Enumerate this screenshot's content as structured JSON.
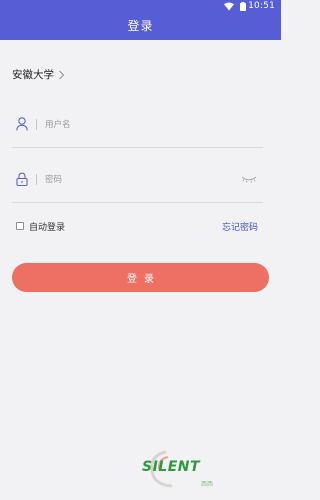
{
  "status_bar": {
    "time": "10:51",
    "icons": [
      "wifi-icon",
      "battery-icon"
    ]
  },
  "header": {
    "title": "登录"
  },
  "school": {
    "name": "安徽大学",
    "icon": "chevron-right-icon"
  },
  "username": {
    "placeholder": "用户名",
    "value": "",
    "icon": "user-icon"
  },
  "password": {
    "placeholder": "密码",
    "value": "",
    "icon": "lock-icon",
    "toggle_icon": "eye-closed-icon"
  },
  "options": {
    "auto_login_label": "自动登录",
    "auto_login_checked": false,
    "forgot_label": "忘记密码"
  },
  "login_button": {
    "label": "登录"
  },
  "watermark": {
    "text": "SILENT",
    "subtext": "西西"
  },
  "colors": {
    "header": "#575dd4",
    "button": "#ee6f63",
    "link": "#3d4fd0",
    "background": "#f2f2f4"
  }
}
